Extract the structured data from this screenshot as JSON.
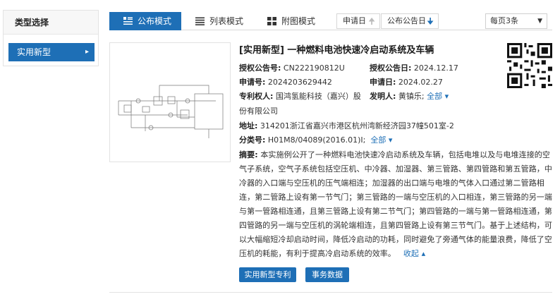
{
  "sidebar": {
    "title": "类型选择",
    "items": [
      {
        "label": "实用新型"
      }
    ]
  },
  "toolbar": {
    "tabs": [
      {
        "label": "公布模式",
        "icon": "list-detail-icon",
        "active": true
      },
      {
        "label": "列表模式",
        "icon": "list-icon",
        "active": false
      },
      {
        "label": "附图模式",
        "icon": "grid-icon",
        "active": false
      }
    ],
    "sort": [
      {
        "label": "申请日",
        "icon": "arrow-up-icon"
      },
      {
        "label": "公布公告日",
        "icon": "arrow-down-icon"
      }
    ],
    "per_page": "每页3条"
  },
  "result": {
    "title": "[实用新型] 一种燃料电池快速冷启动系统及车辆",
    "pub_no_label": "授权公告号:",
    "pub_no": "CN222190812U",
    "pub_date_label": "授权公告日:",
    "pub_date": "2024.12.17",
    "app_no_label": "申请号:",
    "app_no": "2024203629442",
    "app_date_label": "申请日:",
    "app_date": "2024.02.27",
    "patentee_label": "专利权人:",
    "patentee_line1": "国鸿氢能科技（嘉兴）股",
    "patentee_line2": "份有限公司",
    "inventor_label": "发明人:",
    "inventor": "黄镇乐;",
    "inventor_more": "全部",
    "address_label": "地址:",
    "address": "314201浙江省嘉兴市港区杭州湾新经济园37幢501室-2",
    "class_label": "分类号:",
    "class_no": "H01M8/04089(2016.01)I;",
    "class_more": "全部",
    "abstract_label": "摘要:",
    "abstract_text": "本实施例公开了一种燃料电池快速冷启动系统及车辆，包括电堆以及与电堆连接的空气子系统，空气子系统包括空压机、中冷器、加湿器、第三管路、第四管路和第五管路，中冷器的入口端与空压机的压气端相连；加湿器的出口端与电堆的气体入口通过第二管路相连，第二管路上设有第一节气门；第三管路的一端与空压机的入口相连，第三管路的另一端与第一管路相连通，且第三管路上设有第二节气门；第四管路的一端与第一管路相连通，第四管路的另一端与空压机的涡轮端相连，且第四管路上设有第三节气门。基于上述结构，可以大幅缩短冷却启动时间，降低冷启动的功耗，同时避免了旁通气体的能量浪费，降低了空压机的耗能，有利于提高冷启动系统的效率。",
    "collapse": "收起",
    "buttons": [
      "实用新型专利",
      "事务数据"
    ]
  },
  "colors": {
    "primary": "#1e6fb6",
    "border": "#e3e3e3"
  }
}
